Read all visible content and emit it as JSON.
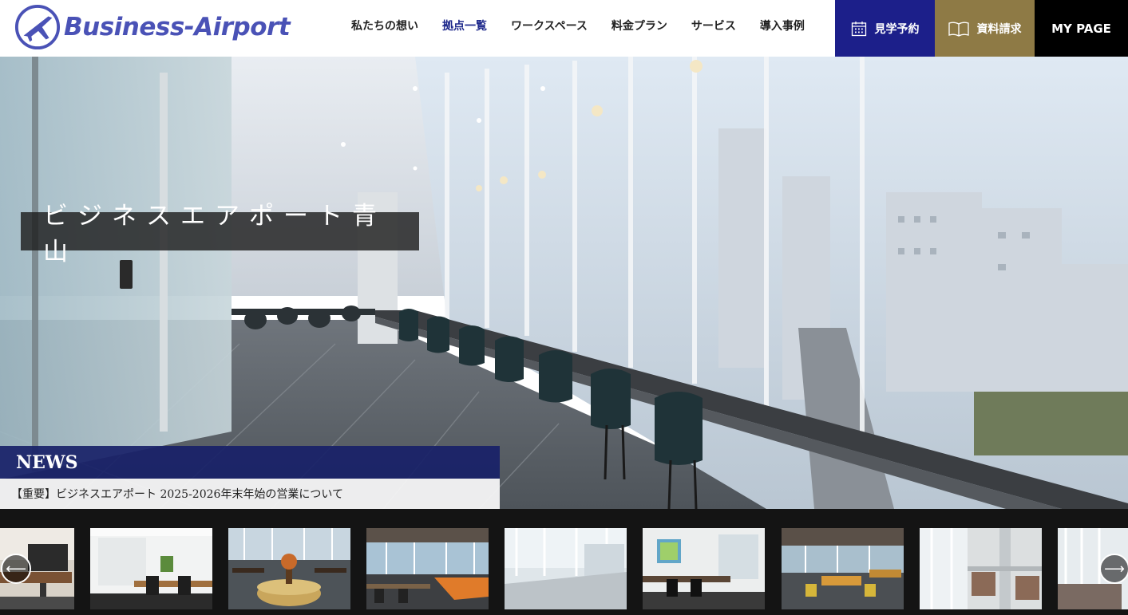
{
  "brand": {
    "name": "Business-Airport",
    "color": "#4a52b6"
  },
  "nav": {
    "items": [
      {
        "label": "私たちの想い",
        "active": false
      },
      {
        "label": "拠点一覧",
        "active": true
      },
      {
        "label": "ワークスペース",
        "active": false
      },
      {
        "label": "料金プラン",
        "active": false
      },
      {
        "label": "サービス",
        "active": false
      },
      {
        "label": "導入事例",
        "active": false
      }
    ]
  },
  "header_buttons": {
    "visit": {
      "label": "見学予約",
      "icon": "calendar-icon",
      "color": "#1c1f8a"
    },
    "docs": {
      "label": "資料請求",
      "icon": "open-book-icon",
      "color": "#8e7a45"
    },
    "mypage": {
      "label": "MY PAGE",
      "color": "#000000"
    }
  },
  "hero": {
    "title": "ビジネスエアポート青山",
    "image": "lounge-with-window-counter-photo"
  },
  "news": {
    "heading": "NEWS",
    "headline": "【重要】ビジネスエアポート 2025-2026年末年始の営業について"
  },
  "carousel": {
    "prev_icon": "arrow-left-icon",
    "next_icon": "arrow-right-icon",
    "thumbnails": [
      "office-desk-photo",
      "private-room-photo",
      "lounge-round-sofa-photo",
      "window-counter-photo",
      "bright-window-photo",
      "office-with-painting-photo",
      "lounge-tables-photo",
      "booth-seating-photo",
      "window-view-photo"
    ]
  }
}
